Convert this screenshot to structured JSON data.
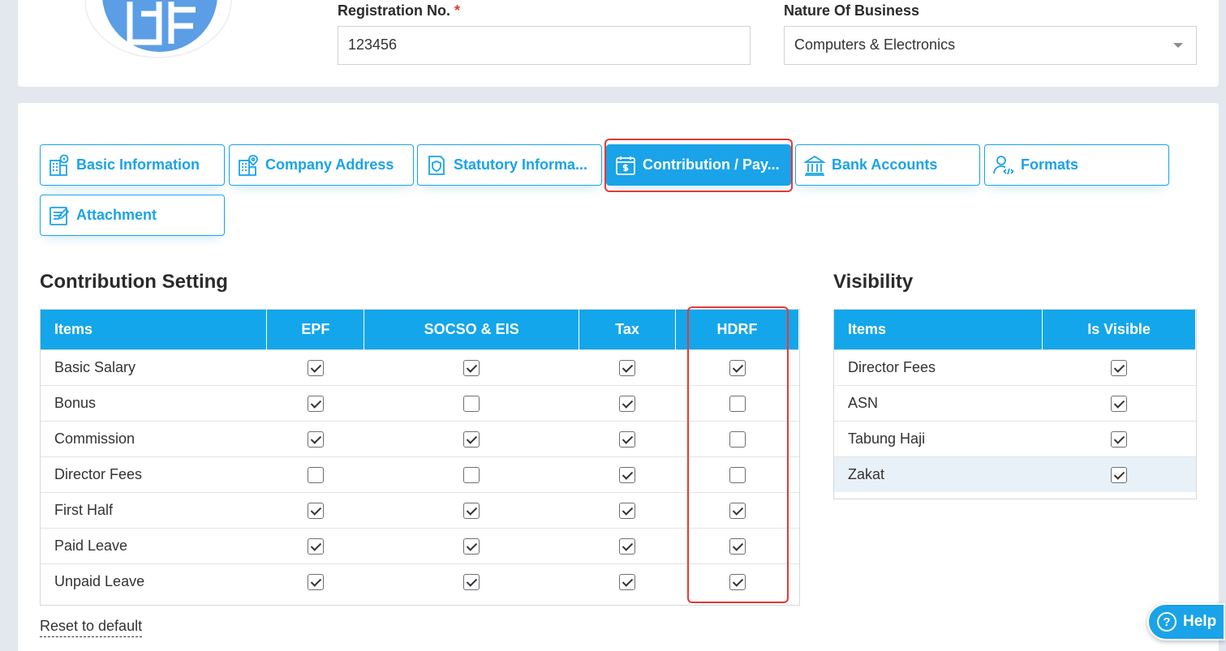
{
  "company": {
    "registration_label": "Registration No.",
    "registration_required": "*",
    "registration_value": "123456",
    "business_label": "Nature Of Business",
    "business_value": "Computers & Electronics"
  },
  "tabs": [
    {
      "label": "Basic Information",
      "icon": "building-info-icon"
    },
    {
      "label": "Company Address",
      "icon": "building-location-icon"
    },
    {
      "label": "Statutory Informa...",
      "icon": "document-shield-icon"
    },
    {
      "label": "Contribution / Pay...",
      "icon": "calendar-dollar-icon",
      "active": true
    },
    {
      "label": "Bank Accounts",
      "icon": "bank-icon"
    },
    {
      "label": "Formats",
      "icon": "user-code-icon"
    },
    {
      "label": "Attachment",
      "icon": "note-edit-icon"
    }
  ],
  "contribution": {
    "title": "Contribution Setting",
    "headers": [
      "Items",
      "EPF",
      "SOCSO & EIS",
      "Tax",
      "HDRF"
    ],
    "rows": [
      {
        "item": "Basic Salary",
        "epf": true,
        "socso": true,
        "tax": true,
        "hdrf": true
      },
      {
        "item": "Bonus",
        "epf": true,
        "socso": false,
        "tax": true,
        "hdrf": false
      },
      {
        "item": "Commission",
        "epf": true,
        "socso": true,
        "tax": true,
        "hdrf": false
      },
      {
        "item": "Director Fees",
        "epf": false,
        "socso": false,
        "tax": true,
        "hdrf": false
      },
      {
        "item": "First Half",
        "epf": true,
        "socso": true,
        "tax": true,
        "hdrf": true
      },
      {
        "item": "Paid Leave",
        "epf": true,
        "socso": true,
        "tax": true,
        "hdrf": true
      },
      {
        "item": "Unpaid Leave",
        "epf": true,
        "socso": true,
        "tax": true,
        "hdrf": true
      }
    ],
    "reset_label": "Reset to default"
  },
  "visibility": {
    "title": "Visibility",
    "headers": [
      "Items",
      "Is Visible"
    ],
    "rows": [
      {
        "item": "Director Fees",
        "visible": true
      },
      {
        "item": "ASN",
        "visible": true
      },
      {
        "item": "Tabung Haji",
        "visible": true
      },
      {
        "item": "Zakat",
        "visible": true,
        "selected": true
      }
    ]
  },
  "help": {
    "label": "Help",
    "icon": "question-circle-icon"
  },
  "colors": {
    "accent": "#1aa3e8",
    "highlight": "#e53935"
  }
}
